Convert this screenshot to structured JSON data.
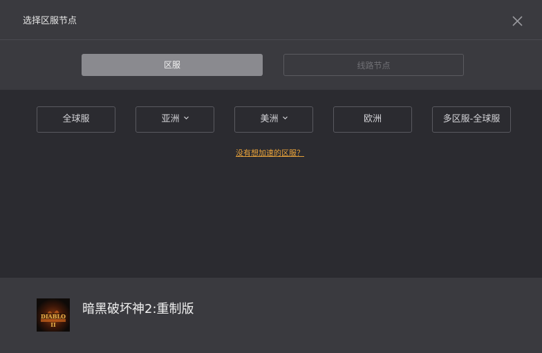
{
  "window": {
    "title": "选择区服节点"
  },
  "tabs": [
    {
      "label": "区服",
      "active": true
    },
    {
      "label": "线路节点",
      "active": false
    }
  ],
  "regions": [
    {
      "label": "全球服",
      "has_dropdown": false
    },
    {
      "label": "亚洲",
      "has_dropdown": true
    },
    {
      "label": "美洲",
      "has_dropdown": true
    },
    {
      "label": "欧洲",
      "has_dropdown": false
    },
    {
      "label": "多区服-全球服",
      "has_dropdown": false
    }
  ],
  "help_link": "没有想加速的区服？",
  "game": {
    "title": "暗黑破坏神2:重制版",
    "icon": "diablo-2-logo-icon"
  },
  "colors": {
    "accent_link": "#e8a23a",
    "active_tab": "#8a8a8f",
    "panel": "#3a3a3f",
    "background": "#2b2b30"
  }
}
